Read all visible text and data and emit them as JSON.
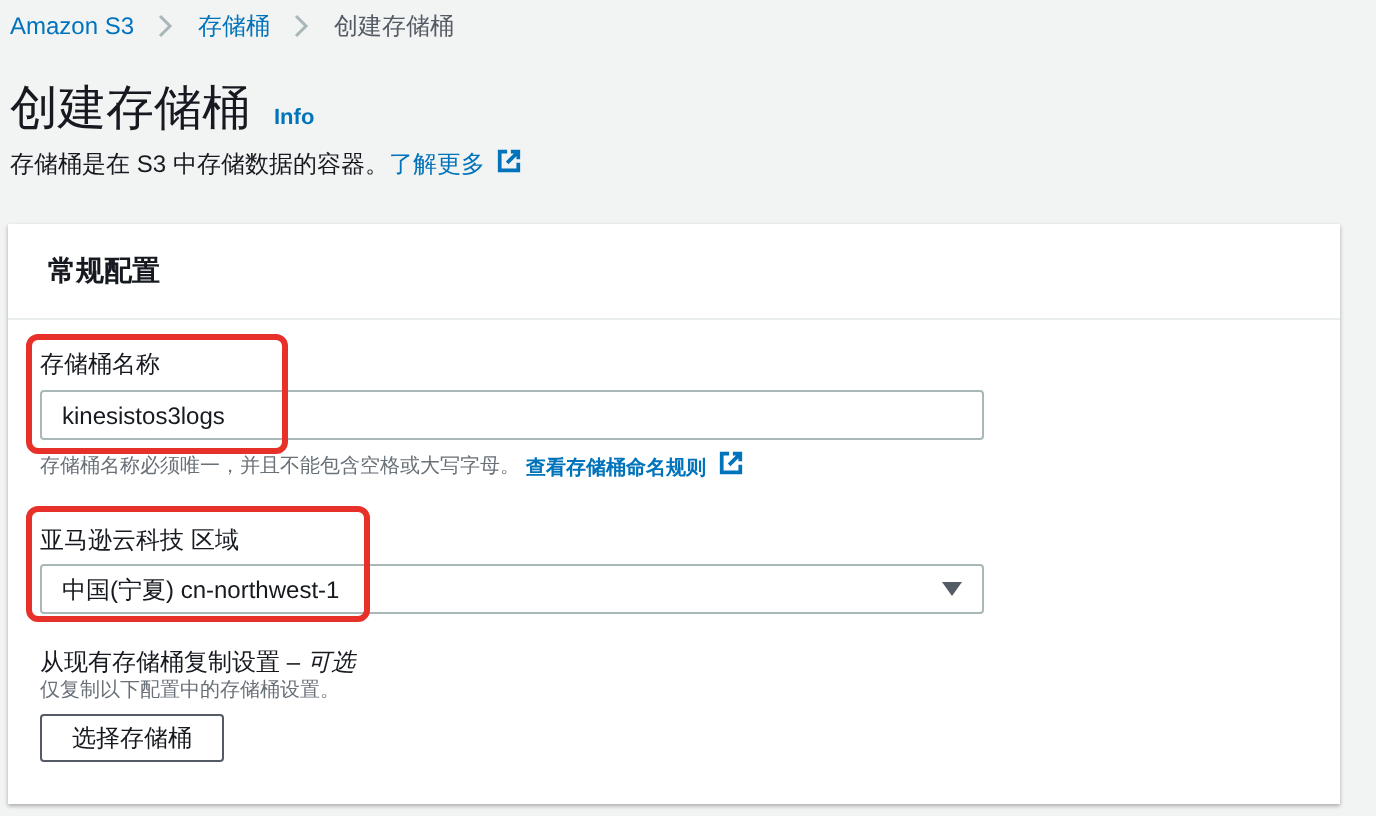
{
  "breadcrumb": [
    {
      "label": "Amazon S3",
      "kind": "link"
    },
    {
      "label": "存储桶",
      "kind": "link"
    },
    {
      "label": "创建存储桶",
      "kind": "current"
    }
  ],
  "page": {
    "title": "创建存储桶",
    "info": "Info",
    "description": "存储桶是在 S3 中存储数据的容器。",
    "learn_more": "了解更多"
  },
  "panel": {
    "title": "常规配置",
    "bucket_name": {
      "label": "存储桶名称",
      "value": "kinesistos3logs",
      "hint": "存储桶名称必须唯一，并且不能包含空格或大写字母。",
      "hint_link": "查看存储桶命名规则",
      "highlighted": true
    },
    "region": {
      "label": "亚马逊云科技 区域",
      "value": "中国(宁夏) cn-northwest-1",
      "highlighted": true
    },
    "copy_settings": {
      "label": "从现有存储桶复制设置 – *可选*",
      "hint": "仅复制以下配置中的存储桶设置。",
      "button": "选择存储桶"
    }
  }
}
